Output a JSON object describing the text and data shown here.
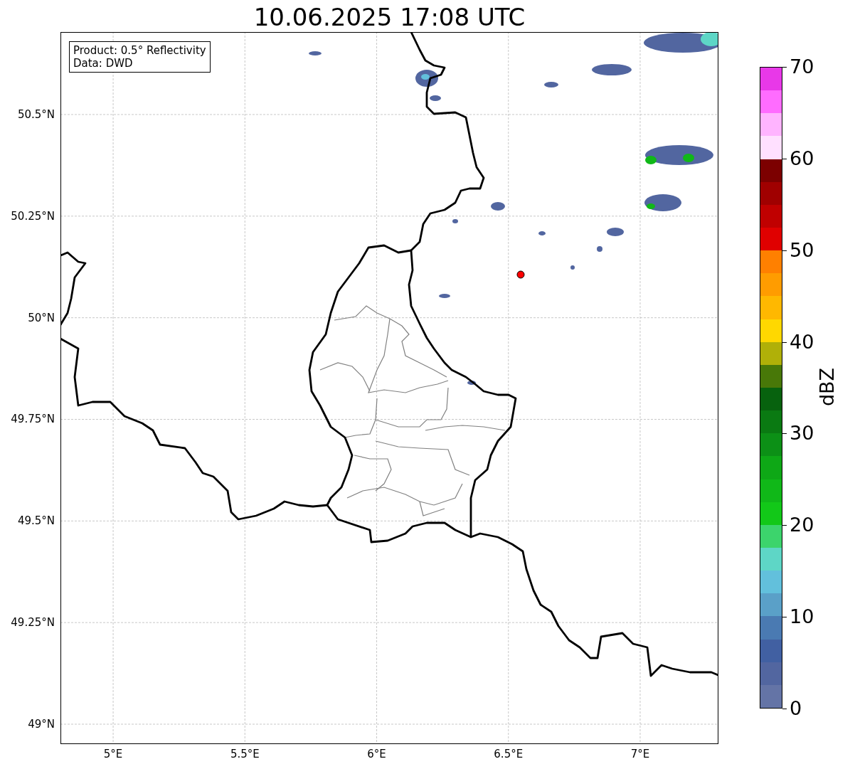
{
  "title": "10.06.2025 17:08 UTC",
  "annotation": {
    "lines": [
      "Product: 0.5° Reflectivity",
      "Data: DWD"
    ]
  },
  "map": {
    "x_ticks": [
      "5°E",
      "5.5°E",
      "6°E",
      "6.5°E",
      "7°E"
    ],
    "y_ticks": [
      "50.5°N",
      "50.25°N",
      "50°N",
      "49.75°N",
      "49.5°N",
      "49.25°N",
      "49°N"
    ]
  },
  "colorbar": {
    "label": "dBZ",
    "ticks": [
      "70",
      "60",
      "50",
      "40",
      "30",
      "20",
      "10",
      "0"
    ],
    "bins": [
      {
        "color": "#6474a6"
      },
      {
        "color": "#5266a0"
      },
      {
        "color": "#4160a2"
      },
      {
        "color": "#4a7ab2"
      },
      {
        "color": "#5aa0c8"
      },
      {
        "color": "#62c0dc"
      },
      {
        "color": "#5ed6c6"
      },
      {
        "color": "#3cd46c"
      },
      {
        "color": "#12c818"
      },
      {
        "color": "#10b818"
      },
      {
        "color": "#0ea816"
      },
      {
        "color": "#0c9016"
      },
      {
        "color": "#0a7a12"
      },
      {
        "color": "#07620e"
      },
      {
        "color": "#487808"
      },
      {
        "color": "#b0b008"
      },
      {
        "color": "#ffd800"
      },
      {
        "color": "#ffb800"
      },
      {
        "color": "#ff9c00"
      },
      {
        "color": "#ff8000"
      },
      {
        "color": "#e00000"
      },
      {
        "color": "#c00000"
      },
      {
        "color": "#a00000"
      },
      {
        "color": "#7c0000"
      },
      {
        "color": "#ffe0ff"
      },
      {
        "color": "#ffb4ff"
      },
      {
        "color": "#ff6cff"
      },
      {
        "color": "#e838e8"
      }
    ]
  }
}
